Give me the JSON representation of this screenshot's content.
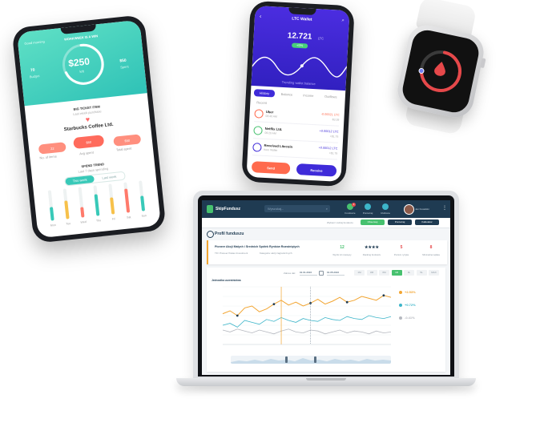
{
  "phone_left": {
    "header_left": "Good morning",
    "header_right": "WORKWEEK IS A WIN",
    "left_stat": "70",
    "left_stat_label": "Budget",
    "amount": "$250",
    "amount_sub": "left",
    "right_stat": "$50",
    "right_stat_label": "Spent",
    "section_title": "BIG TICKET ITEM",
    "section_sub": "Last week purchase",
    "merchant": "Starbucks Coffee Ltd.",
    "pills": [
      "22",
      "$80",
      "$90"
    ],
    "pill_labels": [
      "No. of items",
      "Avg spent",
      "Total spent"
    ],
    "middle_pill": "$61",
    "trend_title": "SPEND TREND",
    "trend_sub": "Last 7 days spending",
    "toggle_left": "This week",
    "toggle_right": "Last week",
    "bar_days": [
      "Mon",
      "Tue",
      "Wed",
      "Thu",
      "Fri",
      "Sat",
      "Sun"
    ],
    "bar_values": [
      0.45,
      0.6,
      0.35,
      0.7,
      0.55,
      0.8,
      0.5
    ],
    "bar_colors": [
      "#38c9b8",
      "#f7c14a",
      "#ff7a6b",
      "#38c9b8",
      "#f7c14a",
      "#ff7a6b",
      "#38c9b8"
    ]
  },
  "phone_middle": {
    "title": "LTC Wallet",
    "balance": "12.721",
    "balance_unit": "LTC",
    "badge": "+5%",
    "chart_caption": "Trending wallet balance",
    "tabs": [
      "History",
      "Balance",
      "Income",
      "Outflows"
    ],
    "active_tab": 0,
    "list_header": "Recent",
    "transactions": [
      {
        "name": "Uber",
        "sub": "08:40 AM",
        "amount": "-0.00021 LTC",
        "fiat": "-$2.09"
      },
      {
        "name": "Netflix Ltd.",
        "sub": "09:20 AM",
        "amount": "+0.00012 LTC",
        "fiat": "+$1.75"
      },
      {
        "name": "Received Litecoin",
        "sub": "from Wallet",
        "amount": "+0.00012 LTC",
        "fiat": "+$1.75"
      }
    ],
    "send_label": "Send",
    "receive_label": "Receive",
    "accent": "#3f2bd9",
    "send_color": "#ff6a4d",
    "receive_color": "#3f2bd9"
  },
  "watch": {
    "ring_level": 0.72,
    "ring_color": "#e6484a",
    "icon": "drop-icon"
  },
  "laptop": {
    "app_name": "SkipFundusz",
    "search_placeholder": "Wyszukaj...",
    "nav_items": [
      "Fundusze",
      "Porównaj",
      "Ulubione"
    ],
    "nav_badge": "3",
    "user_name": "Jan Kowalski",
    "subbar_text": "Wybierz rodzaj funduszu",
    "subbar_buttons": [
      "Obserwuj",
      "Porównaj",
      "Kalkulator"
    ],
    "page_title": "Profil funduszu",
    "fund_name": "Pioneer Akcji Małych i Średnich Spółek Rynków Rozwiniętych",
    "fund_meta_1": "TFI: Pioneer Pekao Investment",
    "fund_meta_2": "Kategoria: akcji zagranicznych",
    "stats": [
      {
        "value": "12",
        "label": "Wynik 12 miesięcy"
      },
      {
        "value": "★★★★",
        "label": "Ranking funduszu"
      },
      {
        "value": "5",
        "label": "Poziom ryzyka"
      },
      {
        "value": "8",
        "label": "Minimalna wpłata"
      }
    ],
    "date_label": "Zakres dat:",
    "date_from": "01.01.2016",
    "date_to": "01.05.2016",
    "range_buttons": [
      "1M",
      "3M",
      "6M",
      "1R",
      "3L",
      "5L",
      "MAX"
    ],
    "active_range": 3,
    "chart_caption": "Jednostka uczestnictwa",
    "legend_values": [
      "+2.53%",
      "+0.72%",
      "-0.41%"
    ],
    "legend_colors": [
      "#f2a531",
      "#3db5c9",
      "#b5b8bf"
    ],
    "accent": "#1f3b52",
    "green": "#47c16f"
  },
  "chart_data": {
    "type": "line",
    "x": [
      1,
      2,
      3,
      4,
      5,
      6,
      7,
      8,
      9,
      10,
      11,
      12,
      13,
      14,
      15,
      16,
      17,
      18,
      19,
      20,
      21,
      22,
      23,
      24
    ],
    "series": [
      {
        "values": [
          52,
          55,
          50,
          58,
          60,
          54,
          57,
          62,
          66,
          61,
          64,
          60,
          63,
          67,
          62,
          65,
          69,
          64,
          66,
          70,
          68,
          66,
          71,
          69
        ]
      },
      {
        "values": [
          40,
          42,
          38,
          45,
          43,
          41,
          46,
          44,
          48,
          45,
          43,
          47,
          45,
          44,
          48,
          46,
          45,
          49,
          47,
          46,
          50,
          48,
          47,
          49
        ]
      },
      {
        "values": [
          35,
          33,
          36,
          34,
          32,
          35,
          33,
          31,
          34,
          36,
          33,
          32,
          35,
          34,
          31,
          33,
          35,
          32,
          34,
          33,
          31,
          34,
          32,
          33
        ]
      }
    ],
    "ylim": [
      20,
      80
    ],
    "grid": true
  }
}
